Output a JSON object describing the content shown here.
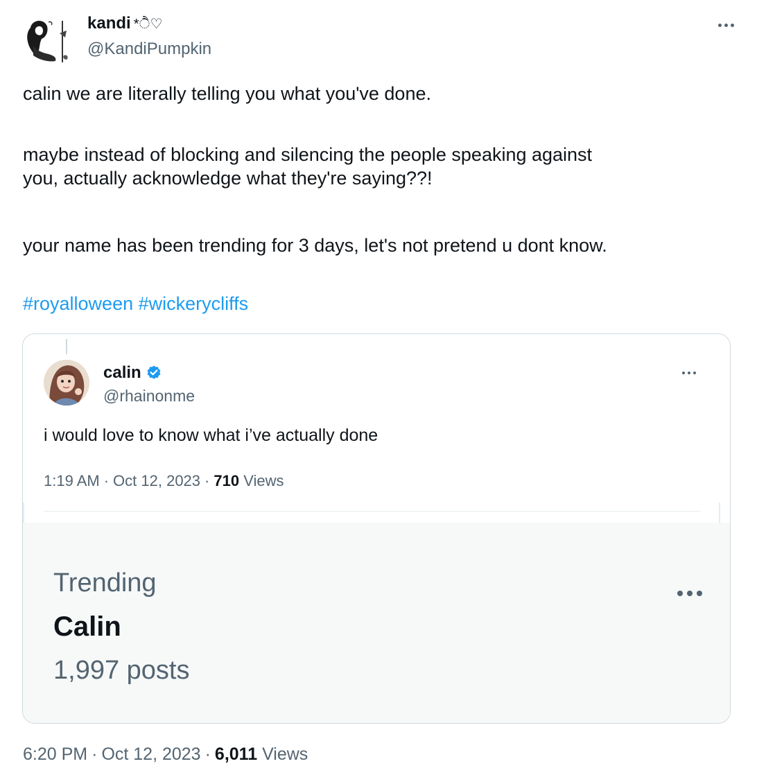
{
  "author": {
    "display_name": "kandi",
    "name_decoration": "*ੈ♡",
    "handle": "@KandiPumpkin"
  },
  "tweet": {
    "lines": [
      "calin we are literally telling you what you've done.",
      "maybe instead of blocking and silencing the people speaking against",
      "you, actually acknowledge what they're saying??!",
      "your name has been trending for 3 days, let's not pretend u dont know."
    ],
    "hashtags": [
      "#royalloween",
      "#wickerycliffs"
    ],
    "time": "6:20 PM",
    "date": "Oct 12, 2023",
    "views_count": "6,011",
    "views_label": "Views",
    "separator": "·"
  },
  "quoted": {
    "display_name": "calin",
    "handle": "@rhainonme",
    "text": "i would love to know what i’ve actually done",
    "time": "1:19 AM",
    "date": "Oct 12, 2023",
    "views_count": "710",
    "views_label": "Views"
  },
  "trending": {
    "label": "Trending",
    "name": "Calin",
    "posts": "1,997 posts"
  },
  "icons": {
    "more": "more-horizontal-icon",
    "verified": "verified-badge-icon"
  },
  "colors": {
    "text": "#0f1419",
    "secondary": "#536471",
    "link": "#1d9bf0",
    "verified": "#1d9bf0",
    "card_border": "#cfd9de",
    "trend_bg": "#f7f9f9"
  }
}
